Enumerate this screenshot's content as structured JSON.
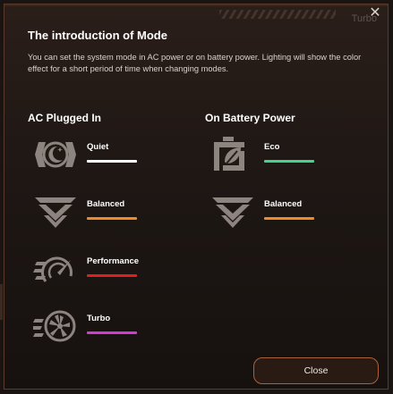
{
  "dialog": {
    "ghost_label": "Turbo",
    "close_icon": "close-x-icon",
    "title": "The introduction of Mode",
    "description": "You can set the system mode in AC power or on battery power. Lighting will show the color effect for a short period of time when changing modes."
  },
  "ac": {
    "heading": "AC Plugged In",
    "modes": [
      {
        "label": "Quiet",
        "icon": "quiet-moon-icon",
        "color": "#ffffff"
      },
      {
        "label": "Balanced",
        "icon": "balanced-chevron-icon",
        "color": "#f08a24"
      },
      {
        "label": "Performance",
        "icon": "performance-gauge-icon",
        "color": "#e11e1e"
      },
      {
        "label": "Turbo",
        "icon": "turbo-fan-icon",
        "color": "#d63ad6"
      }
    ]
  },
  "battery": {
    "heading": "On Battery Power",
    "modes": [
      {
        "label": "Eco",
        "icon": "eco-battery-leaf-icon",
        "color": "#3dd68c"
      },
      {
        "label": "Balanced",
        "icon": "balanced-chevron-icon",
        "color": "#f08a24"
      }
    ]
  },
  "footer": {
    "close_label": "Close"
  }
}
